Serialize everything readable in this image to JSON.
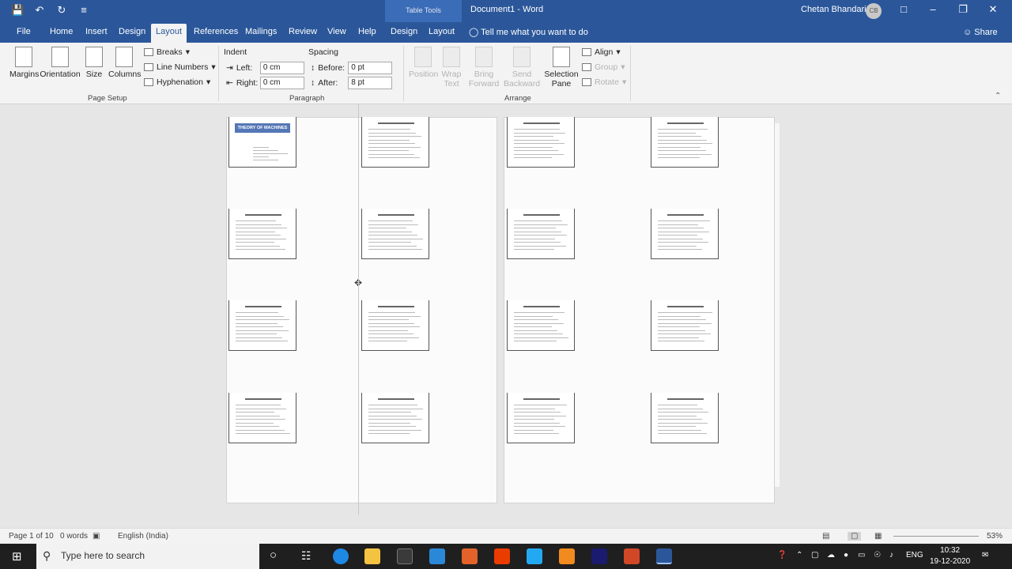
{
  "titlebar": {
    "table_tools": "Table Tools",
    "doc_title": "Document1 - Word",
    "user": "Chetan Bhandari",
    "avatar_initials": "CB"
  },
  "tabs": {
    "file": "File",
    "home": "Home",
    "insert": "Insert",
    "design": "Design",
    "layout": "Layout",
    "references": "References",
    "mailings": "Mailings",
    "review": "Review",
    "view": "View",
    "help": "Help",
    "tt_design": "Design",
    "tt_layout": "Layout",
    "tellme": "Tell me what you want to do",
    "share": "Share"
  },
  "ribbon": {
    "margins": "Margins",
    "orientation": "Orientation",
    "size": "Size",
    "columns": "Columns",
    "breaks": "Breaks",
    "line_numbers": "Line Numbers",
    "hyphenation": "Hyphenation",
    "page_setup": "Page Setup",
    "indent": "Indent",
    "left": "Left:",
    "left_val": "0 cm",
    "right": "Right:",
    "right_val": "0 cm",
    "spacing": "Spacing",
    "before": "Before:",
    "before_val": "0 pt",
    "after": "After:",
    "after_val": "8 pt",
    "paragraph": "Paragraph",
    "position": "Position",
    "wrap": "Wrap",
    "text": "Text",
    "bring": "Bring",
    "forward": "Forward",
    "send": "Send",
    "backward": "Backward",
    "selection": "Selection",
    "pane": "Pane",
    "align": "Align",
    "group": "Group",
    "rotate": "Rotate",
    "arrange": "Arrange"
  },
  "document": {
    "cover_title": "THEORY OF MACHINES"
  },
  "status": {
    "page": "Page 1 of 10",
    "words": "0 words",
    "language": "English (India)",
    "zoom": "53%"
  },
  "taskbar": {
    "search_placeholder": "Type here to search",
    "lang": "ENG",
    "time": "10:32",
    "date": "19-12-2020"
  }
}
